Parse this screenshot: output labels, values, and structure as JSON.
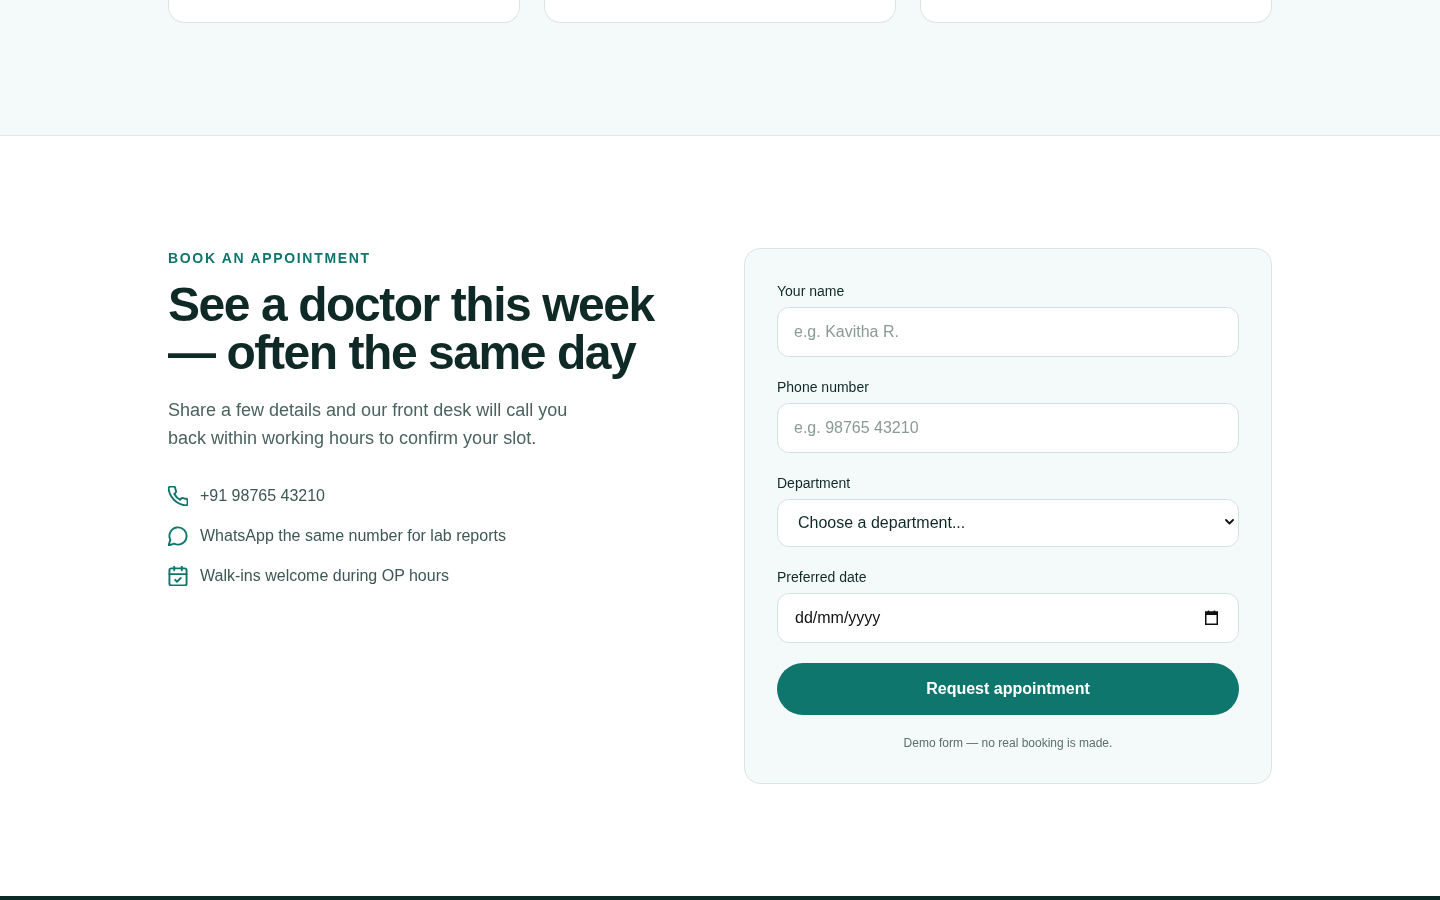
{
  "booking": {
    "eyebrow": "BOOK AN APPOINTMENT",
    "heading": "See a doctor this week — often the same day",
    "intro": "Share a few details and our front desk will call you back within working hours to confirm your slot.",
    "contacts": [
      {
        "kind": "phone",
        "text": "+91 98765 43210"
      },
      {
        "kind": "chat",
        "text": "WhatsApp the same number for lab reports"
      },
      {
        "kind": "calendar",
        "text": "Walk-ins welcome during OP hours"
      }
    ],
    "form": {
      "fields": [
        {
          "kind": "text",
          "label": "Your name",
          "placeholder": "e.g. Kavitha R."
        },
        {
          "kind": "text",
          "label": "Phone number",
          "placeholder": "e.g. 98765 43210"
        },
        {
          "kind": "select",
          "label": "Department",
          "value": "Choose a department..."
        },
        {
          "kind": "date",
          "label": "Preferred date",
          "placeholder": "dd/mm/yyyy"
        }
      ],
      "submit": "Request appointment",
      "note": "Demo form — no real booking is made."
    }
  }
}
